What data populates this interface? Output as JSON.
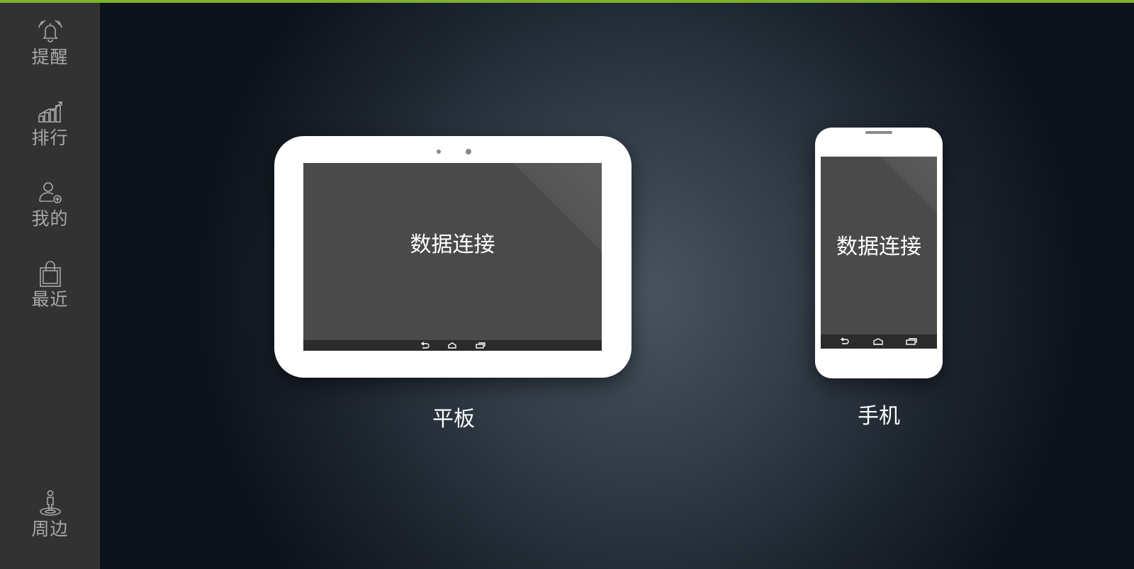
{
  "accent_color": "#7cb32b",
  "sidebar": {
    "items": [
      {
        "label": "提醒",
        "icon": "alarm-bell-icon"
      },
      {
        "label": "排行",
        "icon": "ranking-chart-icon"
      },
      {
        "label": "我的",
        "icon": "user-add-icon"
      },
      {
        "label": "最近",
        "icon": "shopping-bag-icon"
      },
      {
        "label": "周边",
        "icon": "location-person-icon"
      }
    ]
  },
  "devices": {
    "tablet": {
      "label": "平板",
      "screen_text": "数据连接"
    },
    "phone": {
      "label": "手机",
      "screen_text": "数据连接"
    }
  }
}
